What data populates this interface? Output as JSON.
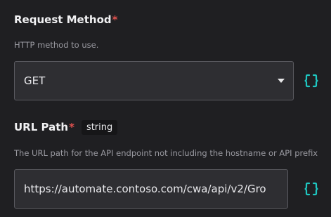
{
  "request_method": {
    "label": "Request Method",
    "required_mark": "*",
    "description": "HTTP method to use.",
    "value": "GET",
    "toggle_icon": "code-brackets-icon"
  },
  "url_path": {
    "label": "URL Path",
    "required_mark": "*",
    "type_badge": "string",
    "description": "The URL path for the API endpoint not including the hostname or API prefix",
    "value": "https://automate.contoso.com/cwa/api/v2/Gro",
    "toggle_icon": "code-brackets-icon"
  },
  "colors": {
    "accent": "#1fc7c1",
    "required": "#e2524f",
    "background": "#1f1f22",
    "input_background": "#2e2e32"
  }
}
